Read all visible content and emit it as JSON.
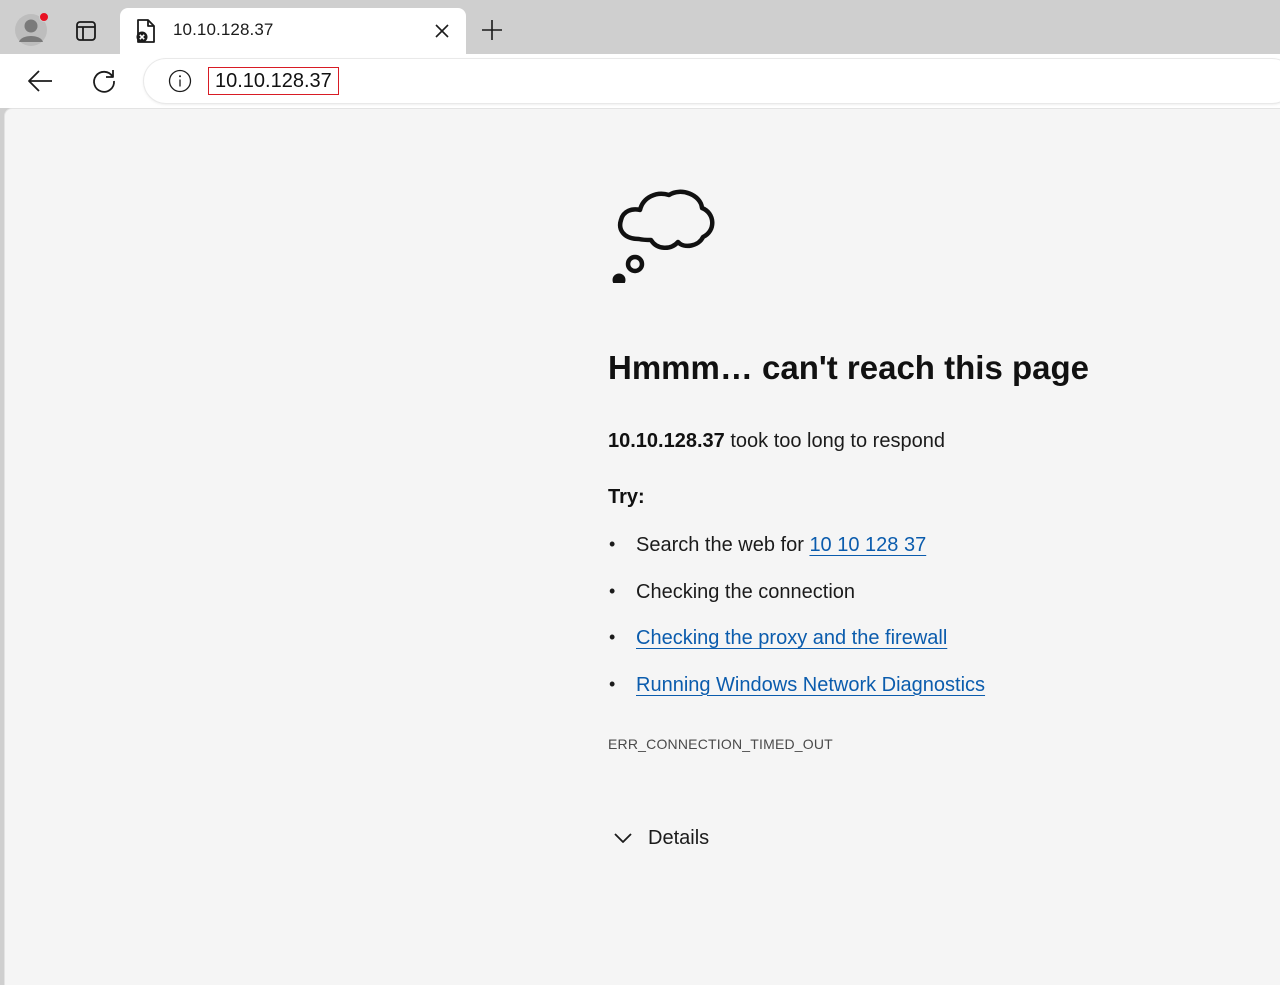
{
  "tab": {
    "title": "10.10.128.37",
    "favicon": "document-error-icon"
  },
  "toolbar": {
    "address": "10.10.128.37"
  },
  "error_page": {
    "heading": "Hmmm… can't reach this page",
    "host": "10.10.128.37",
    "message": " took too long to respond",
    "try_label": "Try:",
    "suggestions": {
      "search_prefix": "Search the web for ",
      "search_link": "10 10 128 37",
      "checking_connection": "Checking the connection",
      "proxy_firewall": "Checking the proxy and the firewall",
      "network_diagnostics": "Running Windows Network Diagnostics"
    },
    "error_code": "ERR_CONNECTION_TIMED_OUT",
    "details_label": "Details"
  },
  "colors": {
    "link": "#0b5cad",
    "address_highlight": "#d81b24",
    "notification_dot": "#e81123"
  }
}
